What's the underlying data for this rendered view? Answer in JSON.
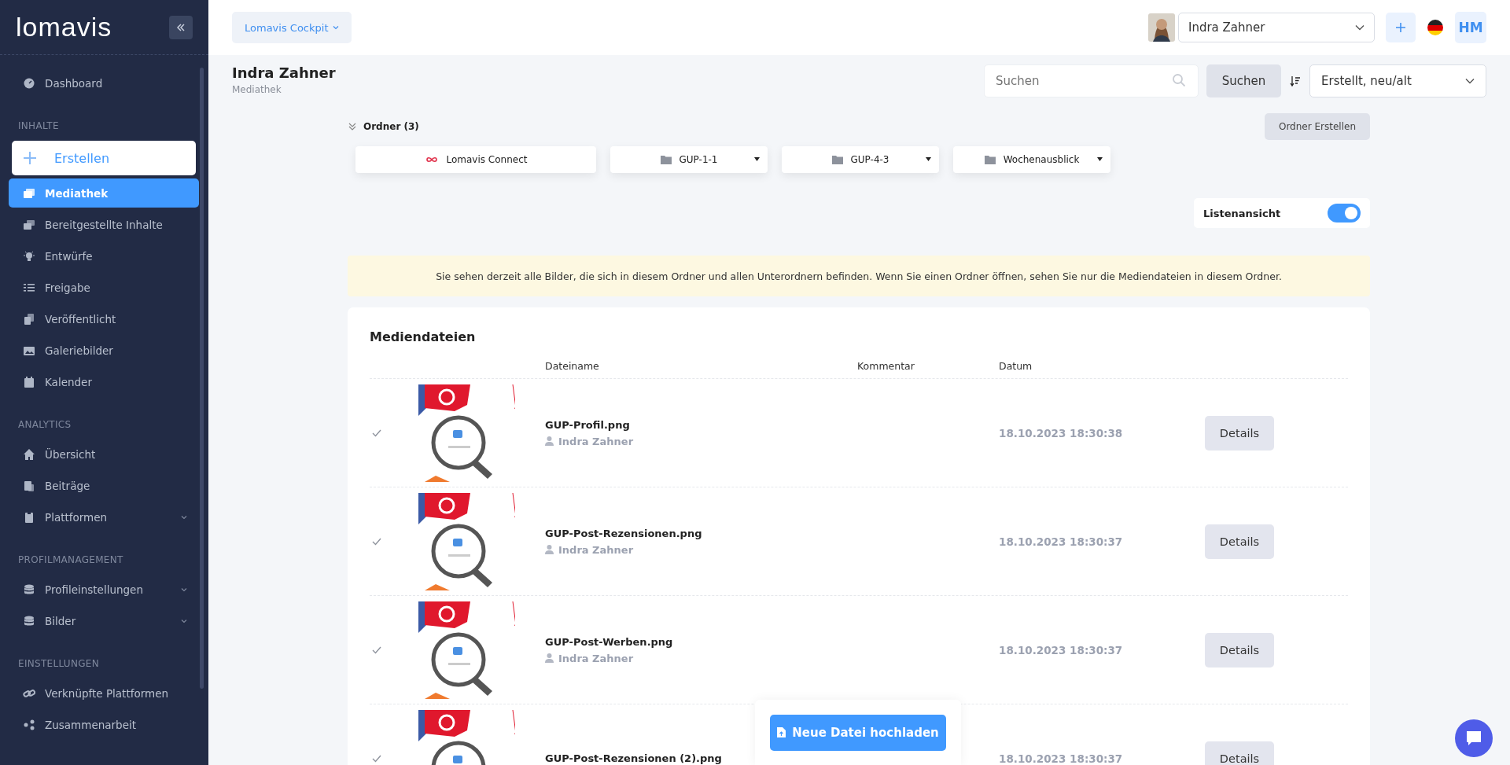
{
  "sidebar": {
    "logo": "lomavis",
    "sections": [
      {
        "items": [
          {
            "label": "Dashboard",
            "selected": false,
            "expandable": false
          }
        ]
      },
      {
        "title": "INHALTE",
        "create": "Erstellen",
        "items": [
          {
            "label": "Mediathek",
            "selected": true,
            "expandable": false
          },
          {
            "label": "Bereitgestellte Inhalte",
            "selected": false,
            "expandable": false
          },
          {
            "label": "Entwürfe",
            "selected": false,
            "expandable": false
          },
          {
            "label": "Freigabe",
            "selected": false,
            "expandable": false
          },
          {
            "label": "Veröffentlicht",
            "selected": false,
            "expandable": false
          },
          {
            "label": "Galeriebilder",
            "selected": false,
            "expandable": false
          },
          {
            "label": "Kalender",
            "selected": false,
            "expandable": false
          }
        ]
      },
      {
        "title": "ANALYTICS",
        "items": [
          {
            "label": "Übersicht",
            "selected": false,
            "expandable": false
          },
          {
            "label": "Beiträge",
            "selected": false,
            "expandable": false
          },
          {
            "label": "Plattformen",
            "selected": false,
            "expandable": true
          }
        ]
      },
      {
        "title": "PROFILMANAGEMENT",
        "items": [
          {
            "label": "Profileinstellungen",
            "selected": false,
            "expandable": true
          },
          {
            "label": "Bilder",
            "selected": false,
            "expandable": true
          }
        ]
      },
      {
        "title": "EINSTELLUNGEN",
        "items": [
          {
            "label": "Verknüpfte Plattformen",
            "selected": false,
            "expandable": false
          },
          {
            "label": "Zusammenarbeit",
            "selected": false,
            "expandable": false
          }
        ]
      }
    ]
  },
  "topbar": {
    "workspace": "Lomavis Cockpit",
    "profile": "Indra Zahner",
    "initials": "HM"
  },
  "header": {
    "title": "Indra Zahner",
    "subtitle": "Mediathek",
    "search_placeholder": "Suchen",
    "search_button": "Suchen",
    "sort": "Erstellt, neu/alt"
  },
  "folders": {
    "title": "Ordner (3)",
    "create_button": "Ordner Erstellen",
    "items": [
      {
        "label": "Lomavis Connect",
        "kind": "root"
      },
      {
        "label": "GUP-1-1",
        "kind": "folder"
      },
      {
        "label": "GUP-4-3",
        "kind": "folder"
      },
      {
        "label": "Wochenausblick",
        "kind": "folder"
      }
    ]
  },
  "list_view": {
    "label": "Listenansicht",
    "on": true
  },
  "notice": "Sie sehen derzeit alle Bilder, die sich in diesem Ordner und allen Unterordnern befinden. Wenn Sie einen Ordner öffnen, sehen Sie nur die Mediendateien in diesem Ordner.",
  "media": {
    "title": "Mediendateien",
    "columns": [
      "Dateiname",
      "Kommentar",
      "Datum"
    ],
    "rows": [
      {
        "name": "GUP-Profil.png",
        "author": "Indra Zahner",
        "date": "18.10.2023 18:30:38",
        "action": "Details"
      },
      {
        "name": "GUP-Post-Rezensionen.png",
        "author": "Indra Zahner",
        "date": "18.10.2023 18:30:37",
        "action": "Details"
      },
      {
        "name": "GUP-Post-Werben.png",
        "author": "Indra Zahner",
        "date": "18.10.2023 18:30:37",
        "action": "Details"
      },
      {
        "name": "GUP-Post-Rezensionen (2).png",
        "date": "18.10.2023 18:30:37",
        "action": "Details"
      }
    ]
  },
  "upload_button": "Neue Datei hochladen"
}
